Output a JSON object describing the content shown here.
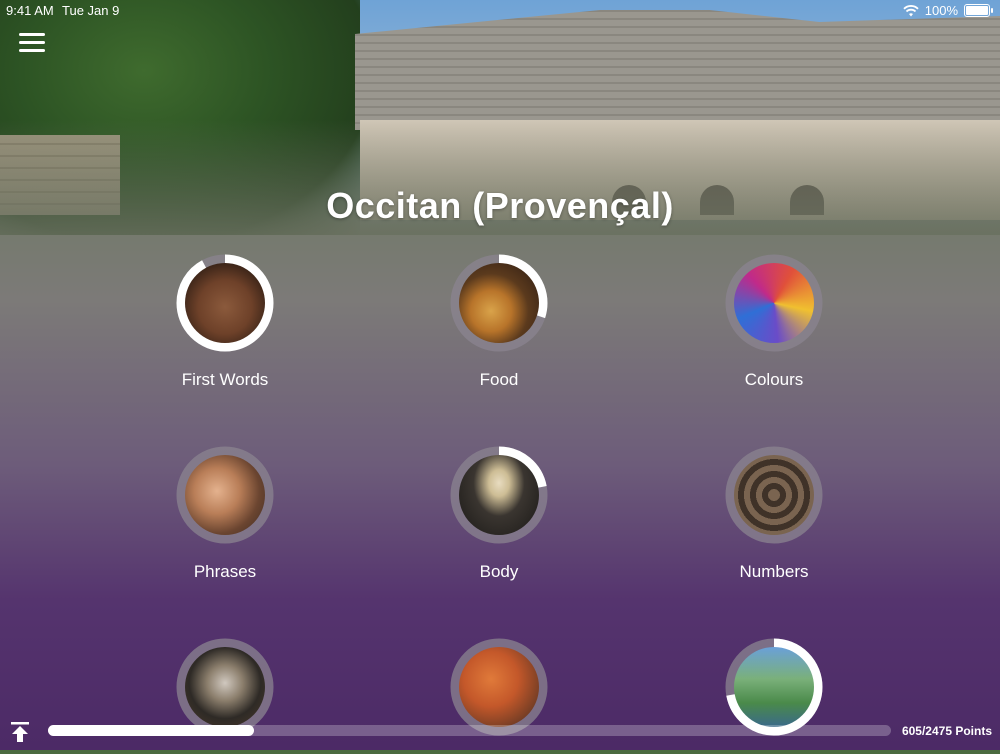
{
  "status": {
    "time": "9:41 AM",
    "date": "Tue Jan 9",
    "battery": "100%"
  },
  "title": "Occitan (Provençal)",
  "categories": [
    {
      "label": "First Words",
      "progress": 0.92,
      "icon": "baby-face-photo"
    },
    {
      "label": "Food",
      "progress": 0.3,
      "icon": "burger-fries-photo"
    },
    {
      "label": "Colours",
      "progress": 0.0,
      "icon": "colour-powder-photo"
    },
    {
      "label": "Phrases",
      "progress": 0.0,
      "icon": "smiling-woman-photo"
    },
    {
      "label": "Body",
      "progress": 0.22,
      "icon": "skeleton-photo"
    },
    {
      "label": "Numbers",
      "progress": 0.0,
      "icon": "wooden-numbers-photo"
    },
    {
      "label": "",
      "progress": 0.0,
      "icon": "alarm-clock-photo"
    },
    {
      "label": "",
      "progress": 0.0,
      "icon": "shopping-cart-photo"
    },
    {
      "label": "",
      "progress": 0.72,
      "icon": "garden-photo"
    }
  ],
  "footer": {
    "points": "605/2475 Points",
    "progress": 0.244
  },
  "colors": {
    "ring_track": "#8b8490",
    "ring_fill": "#ffffff"
  }
}
